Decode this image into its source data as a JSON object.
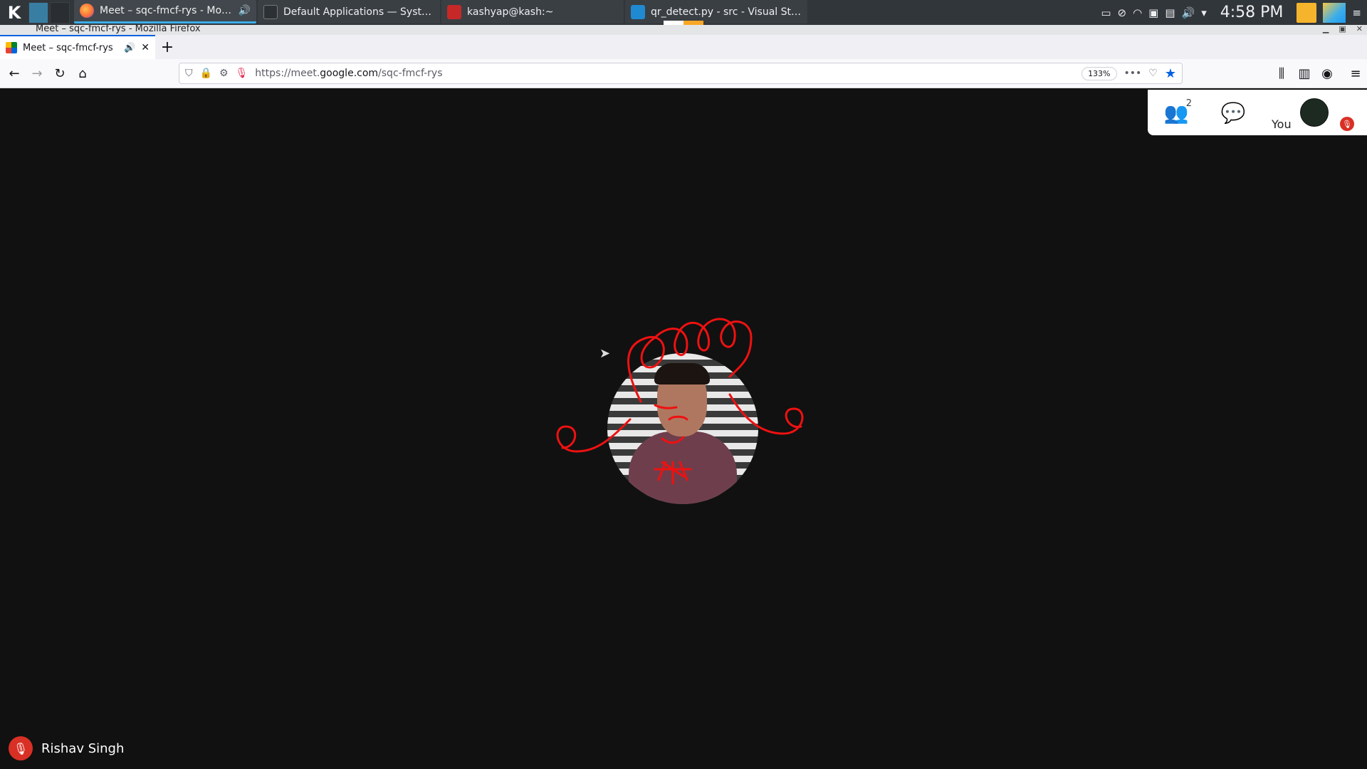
{
  "panel": {
    "tasks": [
      {
        "label": "Meet – sqc-fmcf-rys - Mozilla F...",
        "icon": "firefox-icon",
        "active": true
      },
      {
        "label": "Default Applications  — System Se...",
        "icon": "system-settings-icon"
      },
      {
        "label": "kashyap@kash:~",
        "icon": "terminal-icon"
      },
      {
        "label": "qr_detect.py - src - Visual Studio C...",
        "icon": "vscode-icon"
      }
    ],
    "clock": "4:58 PM"
  },
  "window": {
    "title": "Meet – sqc-fmcf-rys - Mozilla Firefox"
  },
  "browser": {
    "tab_title": "Meet – sqc-fmcf-rys",
    "url_prefix": "https://meet.",
    "url_host": "google.com",
    "url_path": "/sqc-fmcf-rys",
    "zoom": "133%"
  },
  "meet": {
    "participant_count": "2",
    "you_label": "You",
    "participant_name": "Rishav Singh"
  },
  "colors": {
    "accent": "#0061e0",
    "meet_bg": "#111111",
    "mute_red": "#d93025",
    "doodle_red": "#ee1111"
  }
}
